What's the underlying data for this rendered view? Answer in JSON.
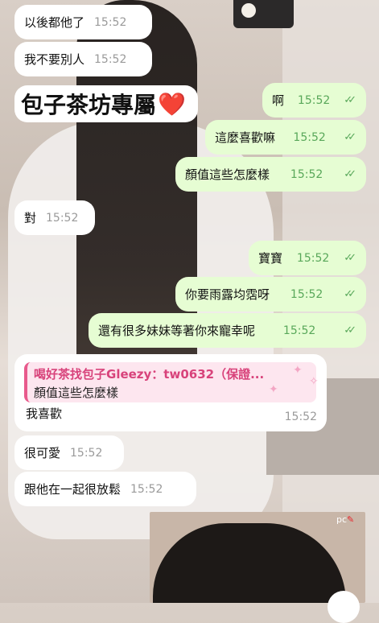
{
  "messages": [
    {
      "text": "以後都他了",
      "time": "15:52"
    },
    {
      "text": "我不要別人",
      "time": "15:52"
    },
    {
      "text": "包子茶坊專屬",
      "emoji": "❤️"
    },
    {
      "text": "啊",
      "time": "15:52"
    },
    {
      "text": "這麼喜歡嘛",
      "time": "15:52"
    },
    {
      "text": "顏值這些怎麼樣",
      "time": "15:52"
    },
    {
      "text": "對",
      "time": "15:52"
    },
    {
      "text": "寶寶",
      "time": "15:52"
    },
    {
      "text": "你要雨露均霑呀",
      "time": "15:52"
    },
    {
      "text": "還有很多妹妹等著你來寵幸呢",
      "time": "15:52"
    },
    {
      "text": "很可愛",
      "time": "15:52"
    },
    {
      "text": "跟他在一起很放鬆",
      "time": "15:52"
    }
  ],
  "reply": {
    "quote_author": "喝好茶找包子Gleezy：tw0632（保證...",
    "quote_text": "顏值這些怎麼樣",
    "text": "我喜歡",
    "time": "15:52"
  },
  "media_badge": "pc",
  "ticks": "✓✓",
  "colors": {
    "outgoing": "#e6fdd3",
    "incoming": "#ffffff",
    "time_out": "#59a85a",
    "quote_accent": "#e85a8c"
  }
}
